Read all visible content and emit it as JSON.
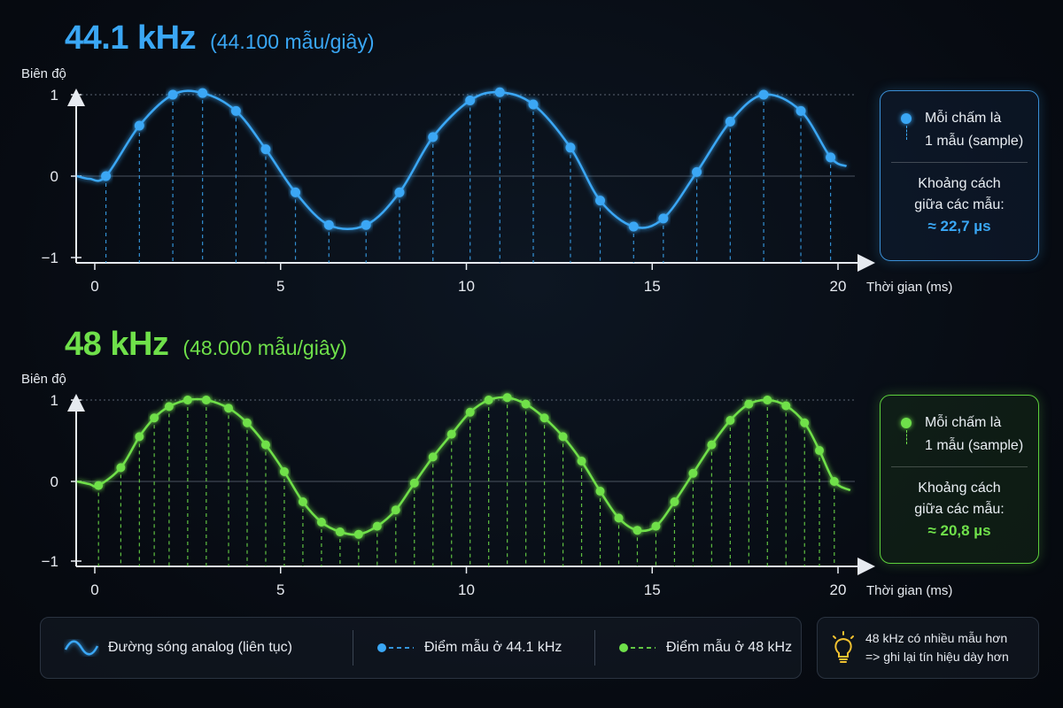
{
  "panels": [
    {
      "title": "44.1 kHz",
      "subtitle": "(44.100 mẫu/giây)",
      "color": "#3aa7f5",
      "info": {
        "marker_text_1": "Mỗi chấm là",
        "marker_text_2": "1 mẫu (sample)",
        "spacing_label_1": "Khoảng cách",
        "spacing_label_2": "giữa các mẫu:",
        "spacing_value": "≈ 22,7 µs"
      }
    },
    {
      "title": "48 kHz",
      "subtitle": "(48.000 mẫu/giây)",
      "color": "#6fe04a",
      "info": {
        "marker_text_1": "Mỗi chấm là",
        "marker_text_2": "1 mẫu (sample)",
        "spacing_label_1": "Khoảng cách",
        "spacing_label_2": "giữa các mẫu:",
        "spacing_value": "≈ 20,8 µs"
      }
    }
  ],
  "legend": {
    "analog": "Đường sóng analog (liên tục)",
    "samples_44": "Điểm mẫu ở 44.1 kHz",
    "samples_48": "Điểm mẫu ở 48 kHz"
  },
  "tip": {
    "line1": "48 kHz có nhiều mẫu hơn",
    "line2": "=> ghi lại tín hiệu dày hơn",
    "icon": "lightbulb-icon"
  },
  "chart_data": [
    {
      "type": "line",
      "ylabel": "Biên độ",
      "xlabel": "Thời gian (ms)",
      "x_ticks": [
        0,
        5,
        10,
        15,
        20
      ],
      "y_ticks": [
        -1,
        0,
        1
      ],
      "ylim": [
        -1,
        1
      ],
      "xlim": [
        0,
        20
      ],
      "series": [
        {
          "x": [
            0.3,
            1.2,
            2.1,
            2.9,
            3.8,
            4.6,
            5.4,
            6.3,
            7.3,
            8.2,
            9.1,
            10.1,
            10.9,
            11.8,
            12.8,
            13.6,
            14.5,
            15.3,
            16.2,
            17.1,
            18.0,
            19.0,
            19.8
          ],
          "y": [
            0.0,
            0.62,
            1.0,
            1.02,
            0.8,
            0.33,
            -0.2,
            -0.6,
            -0.6,
            -0.2,
            0.48,
            0.93,
            1.03,
            0.88,
            0.35,
            -0.3,
            -0.62,
            -0.52,
            0.05,
            0.67,
            1.0,
            0.8,
            0.23
          ]
        }
      ]
    },
    {
      "type": "line",
      "ylabel": "Biên độ",
      "xlabel": "Thời gian (ms)",
      "x_ticks": [
        0,
        5,
        10,
        15,
        20
      ],
      "y_ticks": [
        -1,
        0,
        1
      ],
      "ylim": [
        -1,
        1
      ],
      "xlim": [
        0,
        20
      ],
      "series": [
        {
          "x": [
            0.1,
            0.7,
            1.2,
            1.6,
            2.0,
            2.5,
            3.0,
            3.6,
            4.1,
            4.6,
            5.1,
            5.6,
            6.1,
            6.6,
            7.1,
            7.6,
            8.1,
            8.6,
            9.1,
            9.6,
            10.1,
            10.6,
            11.1,
            11.6,
            12.1,
            12.6,
            13.1,
            13.6,
            14.1,
            14.6,
            15.1,
            15.6,
            16.1,
            16.6,
            17.1,
            17.6,
            18.1,
            18.6,
            19.1,
            19.5,
            19.9
          ],
          "y": [
            -0.05,
            0.17,
            0.55,
            0.78,
            0.92,
            1.0,
            1.0,
            0.9,
            0.72,
            0.45,
            0.12,
            -0.25,
            -0.5,
            -0.62,
            -0.65,
            -0.55,
            -0.35,
            -0.02,
            0.3,
            0.58,
            0.85,
            1.0,
            1.03,
            0.95,
            0.78,
            0.55,
            0.25,
            -0.12,
            -0.45,
            -0.6,
            -0.55,
            -0.25,
            0.1,
            0.45,
            0.75,
            0.95,
            1.0,
            0.93,
            0.72,
            0.38,
            0.0
          ]
        }
      ]
    }
  ]
}
